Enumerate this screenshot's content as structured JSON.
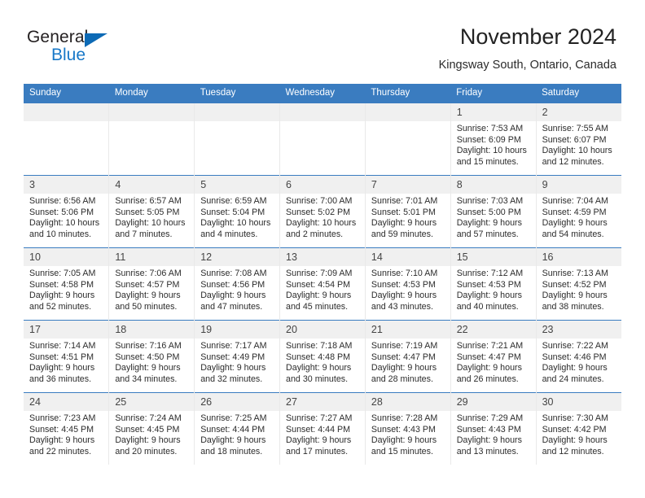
{
  "logo": {
    "word1": "General",
    "word2": "Blue",
    "triangle_color": "#0d6ab5",
    "blue_color": "#1878c8"
  },
  "header": {
    "title": "November 2024",
    "subtitle": "Kingsway South, Ontario, Canada"
  },
  "theme": {
    "header_bar": "#3a7cc0",
    "daynum_bg": "#f0f0f0",
    "text": "#2c2c2c"
  },
  "weekdays": [
    "Sunday",
    "Monday",
    "Tuesday",
    "Wednesday",
    "Thursday",
    "Friday",
    "Saturday"
  ],
  "weeks": [
    [
      {
        "day": "",
        "sunrise": "",
        "sunset": "",
        "daylight": ""
      },
      {
        "day": "",
        "sunrise": "",
        "sunset": "",
        "daylight": ""
      },
      {
        "day": "",
        "sunrise": "",
        "sunset": "",
        "daylight": ""
      },
      {
        "day": "",
        "sunrise": "",
        "sunset": "",
        "daylight": ""
      },
      {
        "day": "",
        "sunrise": "",
        "sunset": "",
        "daylight": ""
      },
      {
        "day": "1",
        "sunrise": "Sunrise: 7:53 AM",
        "sunset": "Sunset: 6:09 PM",
        "daylight": "Daylight: 10 hours and 15 minutes."
      },
      {
        "day": "2",
        "sunrise": "Sunrise: 7:55 AM",
        "sunset": "Sunset: 6:07 PM",
        "daylight": "Daylight: 10 hours and 12 minutes."
      }
    ],
    [
      {
        "day": "3",
        "sunrise": "Sunrise: 6:56 AM",
        "sunset": "Sunset: 5:06 PM",
        "daylight": "Daylight: 10 hours and 10 minutes."
      },
      {
        "day": "4",
        "sunrise": "Sunrise: 6:57 AM",
        "sunset": "Sunset: 5:05 PM",
        "daylight": "Daylight: 10 hours and 7 minutes."
      },
      {
        "day": "5",
        "sunrise": "Sunrise: 6:59 AM",
        "sunset": "Sunset: 5:04 PM",
        "daylight": "Daylight: 10 hours and 4 minutes."
      },
      {
        "day": "6",
        "sunrise": "Sunrise: 7:00 AM",
        "sunset": "Sunset: 5:02 PM",
        "daylight": "Daylight: 10 hours and 2 minutes."
      },
      {
        "day": "7",
        "sunrise": "Sunrise: 7:01 AM",
        "sunset": "Sunset: 5:01 PM",
        "daylight": "Daylight: 9 hours and 59 minutes."
      },
      {
        "day": "8",
        "sunrise": "Sunrise: 7:03 AM",
        "sunset": "Sunset: 5:00 PM",
        "daylight": "Daylight: 9 hours and 57 minutes."
      },
      {
        "day": "9",
        "sunrise": "Sunrise: 7:04 AM",
        "sunset": "Sunset: 4:59 PM",
        "daylight": "Daylight: 9 hours and 54 minutes."
      }
    ],
    [
      {
        "day": "10",
        "sunrise": "Sunrise: 7:05 AM",
        "sunset": "Sunset: 4:58 PM",
        "daylight": "Daylight: 9 hours and 52 minutes."
      },
      {
        "day": "11",
        "sunrise": "Sunrise: 7:06 AM",
        "sunset": "Sunset: 4:57 PM",
        "daylight": "Daylight: 9 hours and 50 minutes."
      },
      {
        "day": "12",
        "sunrise": "Sunrise: 7:08 AM",
        "sunset": "Sunset: 4:56 PM",
        "daylight": "Daylight: 9 hours and 47 minutes."
      },
      {
        "day": "13",
        "sunrise": "Sunrise: 7:09 AM",
        "sunset": "Sunset: 4:54 PM",
        "daylight": "Daylight: 9 hours and 45 minutes."
      },
      {
        "day": "14",
        "sunrise": "Sunrise: 7:10 AM",
        "sunset": "Sunset: 4:53 PM",
        "daylight": "Daylight: 9 hours and 43 minutes."
      },
      {
        "day": "15",
        "sunrise": "Sunrise: 7:12 AM",
        "sunset": "Sunset: 4:53 PM",
        "daylight": "Daylight: 9 hours and 40 minutes."
      },
      {
        "day": "16",
        "sunrise": "Sunrise: 7:13 AM",
        "sunset": "Sunset: 4:52 PM",
        "daylight": "Daylight: 9 hours and 38 minutes."
      }
    ],
    [
      {
        "day": "17",
        "sunrise": "Sunrise: 7:14 AM",
        "sunset": "Sunset: 4:51 PM",
        "daylight": "Daylight: 9 hours and 36 minutes."
      },
      {
        "day": "18",
        "sunrise": "Sunrise: 7:16 AM",
        "sunset": "Sunset: 4:50 PM",
        "daylight": "Daylight: 9 hours and 34 minutes."
      },
      {
        "day": "19",
        "sunrise": "Sunrise: 7:17 AM",
        "sunset": "Sunset: 4:49 PM",
        "daylight": "Daylight: 9 hours and 32 minutes."
      },
      {
        "day": "20",
        "sunrise": "Sunrise: 7:18 AM",
        "sunset": "Sunset: 4:48 PM",
        "daylight": "Daylight: 9 hours and 30 minutes."
      },
      {
        "day": "21",
        "sunrise": "Sunrise: 7:19 AM",
        "sunset": "Sunset: 4:47 PM",
        "daylight": "Daylight: 9 hours and 28 minutes."
      },
      {
        "day": "22",
        "sunrise": "Sunrise: 7:21 AM",
        "sunset": "Sunset: 4:47 PM",
        "daylight": "Daylight: 9 hours and 26 minutes."
      },
      {
        "day": "23",
        "sunrise": "Sunrise: 7:22 AM",
        "sunset": "Sunset: 4:46 PM",
        "daylight": "Daylight: 9 hours and 24 minutes."
      }
    ],
    [
      {
        "day": "24",
        "sunrise": "Sunrise: 7:23 AM",
        "sunset": "Sunset: 4:45 PM",
        "daylight": "Daylight: 9 hours and 22 minutes."
      },
      {
        "day": "25",
        "sunrise": "Sunrise: 7:24 AM",
        "sunset": "Sunset: 4:45 PM",
        "daylight": "Daylight: 9 hours and 20 minutes."
      },
      {
        "day": "26",
        "sunrise": "Sunrise: 7:25 AM",
        "sunset": "Sunset: 4:44 PM",
        "daylight": "Daylight: 9 hours and 18 minutes."
      },
      {
        "day": "27",
        "sunrise": "Sunrise: 7:27 AM",
        "sunset": "Sunset: 4:44 PM",
        "daylight": "Daylight: 9 hours and 17 minutes."
      },
      {
        "day": "28",
        "sunrise": "Sunrise: 7:28 AM",
        "sunset": "Sunset: 4:43 PM",
        "daylight": "Daylight: 9 hours and 15 minutes."
      },
      {
        "day": "29",
        "sunrise": "Sunrise: 7:29 AM",
        "sunset": "Sunset: 4:43 PM",
        "daylight": "Daylight: 9 hours and 13 minutes."
      },
      {
        "day": "30",
        "sunrise": "Sunrise: 7:30 AM",
        "sunset": "Sunset: 4:42 PM",
        "daylight": "Daylight: 9 hours and 12 minutes."
      }
    ]
  ]
}
